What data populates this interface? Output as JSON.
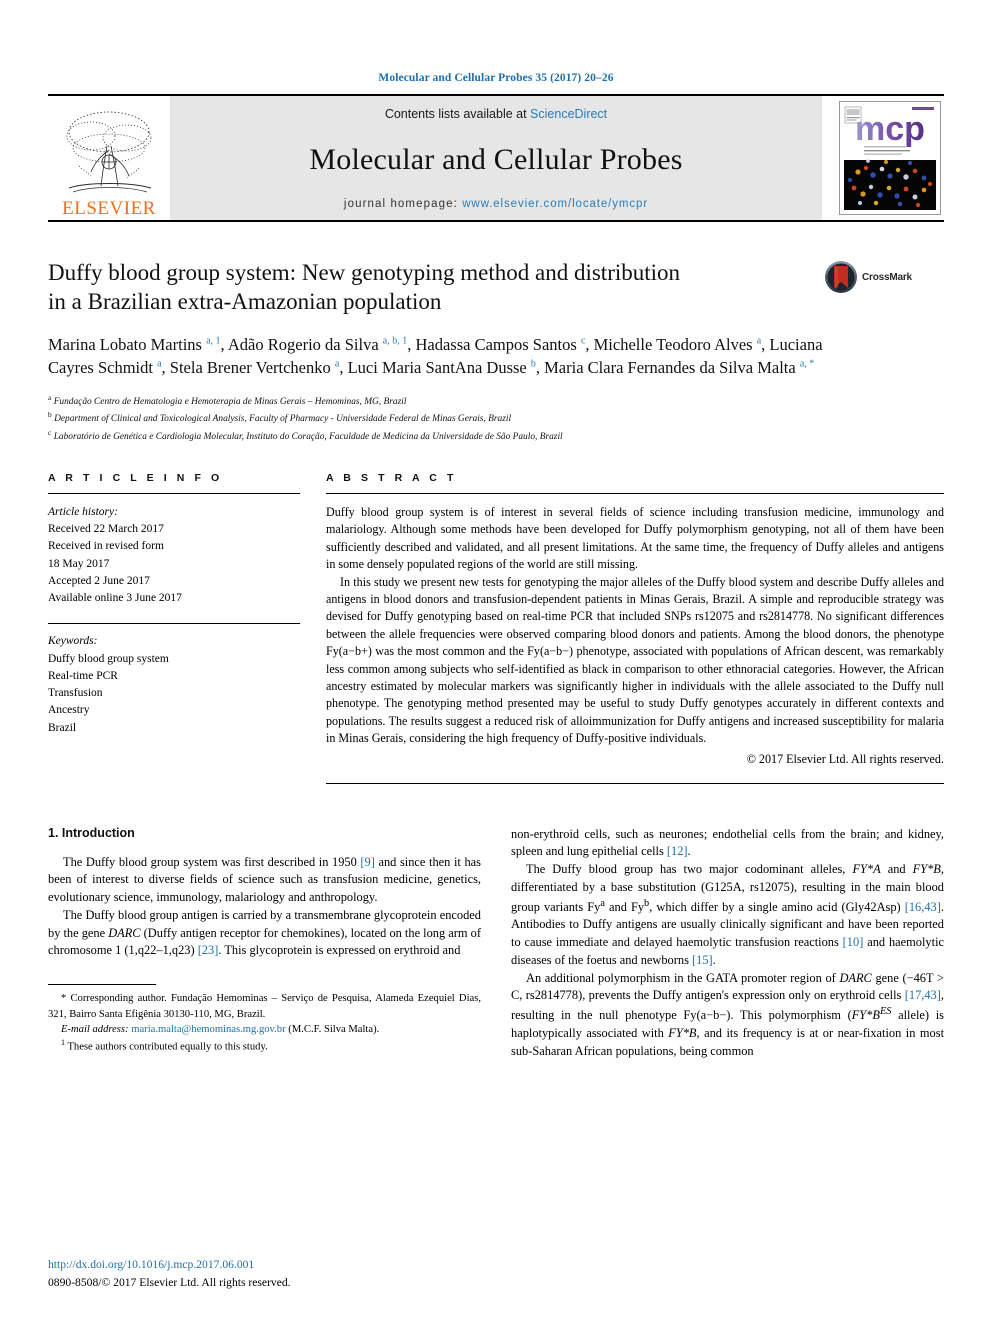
{
  "running_head": "Molecular and Cellular Probes 35 (2017) 20–26",
  "masthead": {
    "publisher": "ELSEVIER",
    "contents_prefix": "Contents lists available at ",
    "contents_link": "ScienceDirect",
    "journal_title": "Molecular and Cellular Probes",
    "homepage_prefix": "journal homepage: ",
    "homepage_url": "www.elsevier.com/locate/ymcpr",
    "cover_wordmark": "mcp"
  },
  "article": {
    "title_line1": "Duffy blood group system: New genotyping method and distribution",
    "title_line2": "in a Brazilian extra-Amazonian population",
    "crossmark_label": "CrossMark",
    "authors_html": "Marina Lobato Martins <sup>a, 1</sup>, Adão Rogerio da Silva <sup>a, b, 1</sup>, Hadassa Campos Santos <sup>c</sup>, Michelle Teodoro Alves <sup>a</sup>, Luciana Cayres Schmidt <sup>a</sup>, Stela Brener Vertchenko <sup>a</sup>, Luci Maria SantAna Dusse <sup>b</sup>, Maria Clara Fernandes da Silva Malta <sup>a, *</sup>",
    "affiliations": [
      {
        "marker": "a",
        "text": "Fundação Centro de Hematologia e Hemoterapia de Minas Gerais – Hemominas, MG, Brazil"
      },
      {
        "marker": "b",
        "text": "Department of Clinical and Toxicological Analysis, Faculty of Pharmacy - Universidade Federal de Minas Gerais, Brazil"
      },
      {
        "marker": "c",
        "text": "Laboratório de Genética e Cardiologia Molecular, Instituto do Coração, Faculdade de Medicina da Universidade de São Paulo, Brazil"
      }
    ]
  },
  "article_info": {
    "heading": "A R T I C L E   I N F O",
    "history_label": "Article history:",
    "history": [
      "Received 22 March 2017",
      "Received in revised form",
      "18 May 2017",
      "Accepted 2 June 2017",
      "Available online 3 June 2017"
    ],
    "keywords_label": "Keywords:",
    "keywords": [
      "Duffy blood group system",
      "Real-time PCR",
      "Transfusion",
      "Ancestry",
      "Brazil"
    ]
  },
  "abstract": {
    "heading": "A B S T R A C T",
    "paragraphs": [
      "Duffy blood group system is of interest in several fields of science including transfusion medicine, immunology and malariology. Although some methods have been developed for Duffy polymorphism genotyping, not all of them have been sufficiently described and validated, and all present limitations. At the same time, the frequency of Duffy alleles and antigens in some densely populated regions of the world are still missing.",
      "In this study we present new tests for genotyping the major alleles of the Duffy blood system and describe Duffy alleles and antigens in blood donors and transfusion-dependent patients in Minas Gerais, Brazil. A simple and reproducible strategy was devised for Duffy genotyping based on real-time PCR that included SNPs rs12075 and rs2814778. No significant differences between the allele frequencies were observed comparing blood donors and patients. Among the blood donors, the phenotype Fy(a−b+) was the most common and the Fy(a−b−) phenotype, associated with populations of African descent, was remarkably less common among subjects who self-identified as black in comparison to other ethnoracial categories. However, the African ancestry estimated by molecular markers was significantly higher in individuals with the allele associated to the Duffy null phenotype. The genotyping method presented may be useful to study Duffy genotypes accurately in different contexts and populations. The results suggest a reduced risk of alloimmunization for Duffy antigens and increased susceptibility for malaria in Minas Gerais, considering the high frequency of Duffy-positive individuals."
    ],
    "copyright": "© 2017 Elsevier Ltd. All rights reserved."
  },
  "introduction": {
    "heading": "1.  Introduction",
    "left_paragraphs_html": [
      "The Duffy blood group system was first described in 1950 <span class=\"ref\">[9]</span> and since then it has been of interest to diverse fields of science such as transfusion medicine, genetics, evolutionary science, immunology, malariology and anthropology.",
      "The Duffy blood group antigen is carried by a transmembrane glycoprotein encoded by the gene <span class=\"ital\">DARC</span> (Duffy antigen receptor for chemokines), located on the long arm of chromosome 1 (1,q22–1,q23) <span class=\"ref\">[23]</span>. This glycoprotein is expressed on erythroid and"
    ],
    "right_paragraphs_html": [
      "non-erythroid cells, such as neurones; endothelial cells from the brain; and kidney, spleen and lung epithelial cells <span class=\"ref\">[12]</span>.",
      "The Duffy blood group has two major codominant alleles, <span class=\"ital\">FY*A</span> and <span class=\"ital\">FY*B</span>, differentiated by a base substitution (G125A, rs12075), resulting in the main blood group variants Fy<sup>a</sup> and Fy<sup>b</sup>, which differ by a single amino acid (Gly42Asp) <span class=\"ref\">[16,43]</span>. Antibodies to Duffy antigens are usually clinically significant and have been reported to cause immediate and delayed haemolytic transfusion reactions <span class=\"ref\">[10]</span> and haemolytic diseases of the foetus and newborns <span class=\"ref\">[15]</span>.",
      "An additional polymorphism in the GATA promoter region of <span class=\"ital\">DARC</span> gene (−46T &gt; C, rs2814778), prevents the Duffy antigen's expression only on erythroid cells <span class=\"ref\">[17,43]</span>, resulting in the null phenotype Fy(a−b−). This polymorphism (<span class=\"ital\">FY*B</span><sup class=\"ital\">ES</sup> allele) is haplotypically associated with <span class=\"ital\">FY*B</span>, and its frequency is at or near-fixation in most sub-Saharan African populations, being common"
    ]
  },
  "footnotes": {
    "corresponding_html": "* Corresponding author. Fundação Hemominas – Serviço de Pesquisa, Alameda Ezequiel Dias, 321, Bairro Santa Efigênia 30130-110, MG, Brazil.",
    "email_label": "E-mail address:",
    "email": "maria.malta@hemominas.mg.gov.br",
    "email_suffix": "(M.C.F. Silva Malta).",
    "equal_contribution_html": "<sup>1</sup>  These authors contributed equally to this study."
  },
  "bottom": {
    "doi": "http://dx.doi.org/10.1016/j.mcp.2017.06.001",
    "issn_line": "0890-8508/© 2017 Elsevier Ltd. All rights reserved."
  },
  "colors": {
    "link_blue": "#1f6fa8",
    "elsevier_orange": "#f06f1e",
    "masthead_grey": "#e6e6e6"
  }
}
